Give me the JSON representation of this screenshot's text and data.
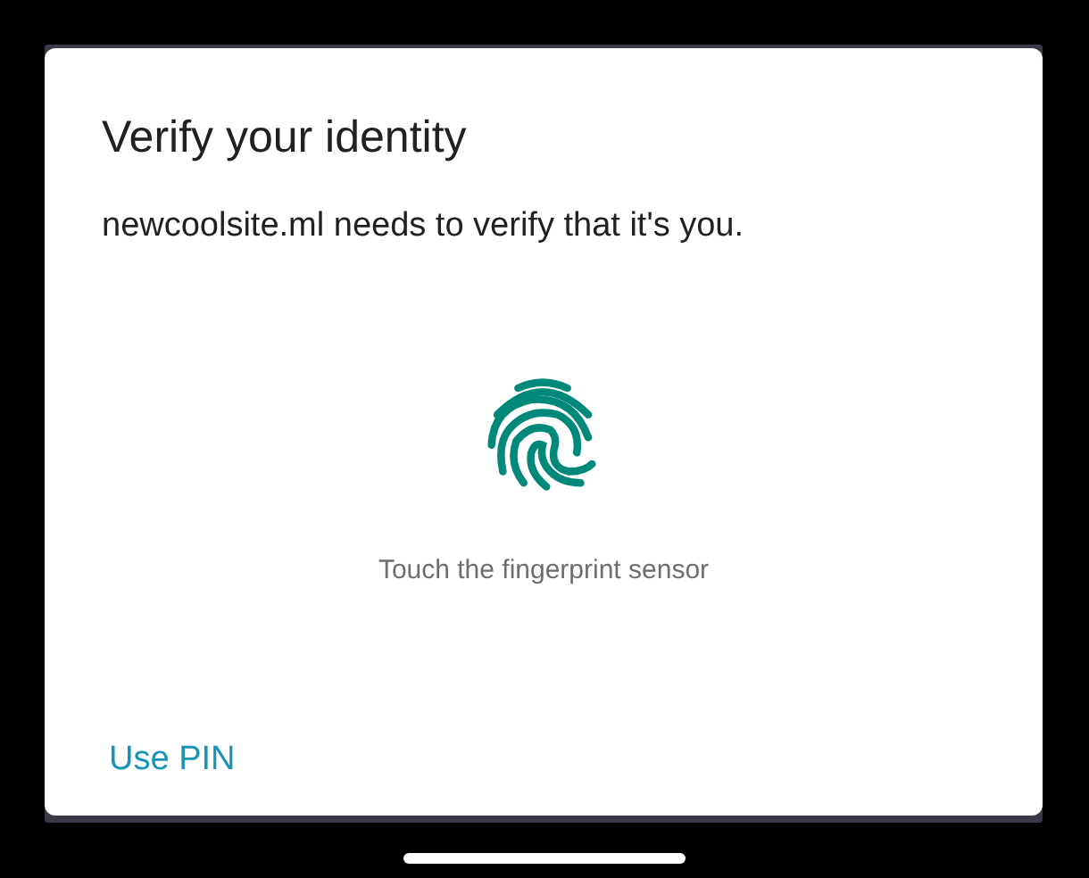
{
  "dialog": {
    "title": "Verify your identity",
    "message": "newcoolsite.ml needs to verify that it's you.",
    "hint": "Touch the fingerprint sensor",
    "buttons": [
      {
        "label": "Use PIN"
      }
    ]
  }
}
